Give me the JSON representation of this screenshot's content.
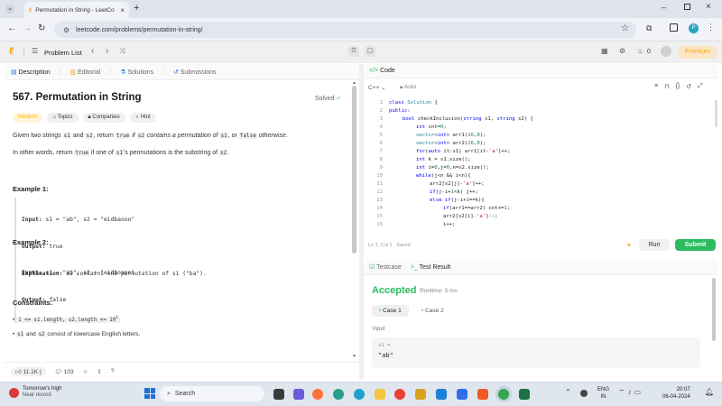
{
  "browser": {
    "tab_title": "Permutation in String - LeetCo",
    "url": "leetcode.com/problems/permutation-in-string/",
    "profile_initial": "P"
  },
  "nav": {
    "problem_list": "Problem List",
    "streak_count": "0",
    "premium": "Premium"
  },
  "problem": {
    "tabs": [
      "Description",
      "Editorial",
      "Solutions",
      "Submissions"
    ],
    "title": "567. Permutation in String",
    "solved": "Solved",
    "tags": [
      "Medium",
      "Topics",
      "Companies",
      "Hint"
    ],
    "desc1_a": "Given two strings",
    "desc1_s1": "s1",
    "desc1_and": "and",
    "desc1_s2": "s2",
    "desc1_ret": ", return",
    "desc1_true": "true",
    "desc1_if": "if",
    "desc1_s2b": "s2",
    "desc1_cont": "contains a permutation of",
    "desc1_s1b": "s1",
    "desc1_or": ", or",
    "desc1_false": "false",
    "desc1_other": "otherwise.",
    "desc2_a": "In other words, return",
    "desc2_true": "true",
    "desc2_if": "if one of",
    "desc2_s1": "s1",
    "desc2_perm": "'s permutations is the substring of",
    "desc2_s2": "s2",
    "desc2_end": ".",
    "ex1_title": "Example 1:",
    "ex1_input_label": "Input:",
    "ex1_input": "s1 = \"ab\", s2 = \"eidbaooo\"",
    "ex1_output_label": "Output:",
    "ex1_output": "true",
    "ex1_expl_label": "Explanation:",
    "ex1_expl": "s2 contains one permutation of s1 (\"ba\").",
    "ex2_title": "Example 2:",
    "ex2_input_label": "Input:",
    "ex2_input": "s1 = \"ab\", s2 = \"eidboaoo\"",
    "ex2_output_label": "Output:",
    "ex2_output": "false",
    "constraints_title": "Constraints:",
    "c1": "1 <= s1.length, s2.length <= 10",
    "c1_sup": "4",
    "c2_s1": "s1",
    "c2_and": "and",
    "c2_s2": "s2",
    "c2_rest": "consist of lowercase English letters.",
    "likes": "11.1K",
    "comments": "103"
  },
  "editor": {
    "header": "Code",
    "language": "C++",
    "mode": "Auto",
    "line_numbers": [
      "1",
      "2",
      "3",
      "4",
      "5",
      "6",
      "7",
      "8",
      "9",
      "10",
      "11",
      "12",
      "13",
      "14",
      "15",
      "16"
    ],
    "status": "Ln 1, Col 1",
    "saved": "Saved",
    "run": "Run",
    "submit": "Submit"
  },
  "results": {
    "tab_testcase": "Testcase",
    "tab_result": "Test Result",
    "accepted": "Accepted",
    "runtime": "Runtime: 5 ms",
    "case1": "Case 1",
    "case2": "Case 2",
    "input_label": "Input",
    "var_label": "s1 =",
    "var_value": "\"ab\""
  },
  "taskbar": {
    "weather_title": "Tomorrow's high",
    "weather_sub": "Near record",
    "search": "Search",
    "lang1": "ENG",
    "lang2": "IN",
    "time": "20:07",
    "date": "06-04-2024"
  },
  "colors": {
    "accent_green": "#2cbb5d",
    "medium_badge": "#ffb800",
    "brand_orange": "#ffa116"
  }
}
